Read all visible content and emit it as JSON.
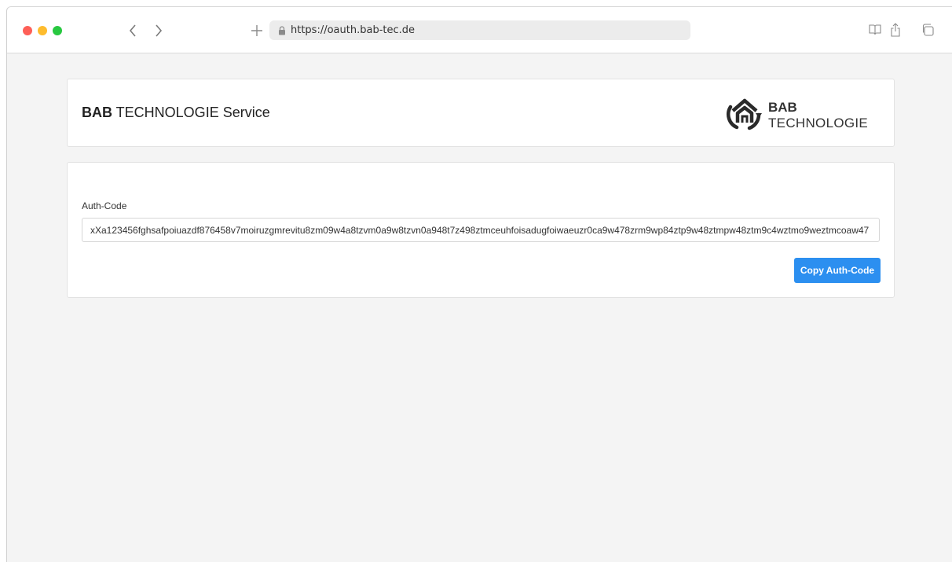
{
  "browser": {
    "url": "https://oauth.bab-tec.de",
    "icons": [
      "back-icon",
      "forward-icon",
      "new-tab-icon",
      "lock-icon",
      "reader-icon",
      "share-icon",
      "tabs-icon"
    ]
  },
  "header": {
    "title_bold": "BAB",
    "title_rest": " TECHNOLOGIE Service",
    "logo_line1": "BAB",
    "logo_line2": "TECHNOLOGIE"
  },
  "auth": {
    "label": "Auth-Code",
    "code": "xXa123456fghsafpoiuazdf876458v7moiruzgmrevitu8zm09w4a8tzvm0a9w8tzvn0a948t7z498ztmceuhfoisadugfoiwaeuzr0ca9w478zrm9wp84ztp9w48ztmpw48ztm9c4wztmo9weztmcoaw47",
    "button_label": "Copy Auth-Code"
  },
  "colors": {
    "accent": "#2c8ff0",
    "page_background": "#f4f4f4"
  }
}
